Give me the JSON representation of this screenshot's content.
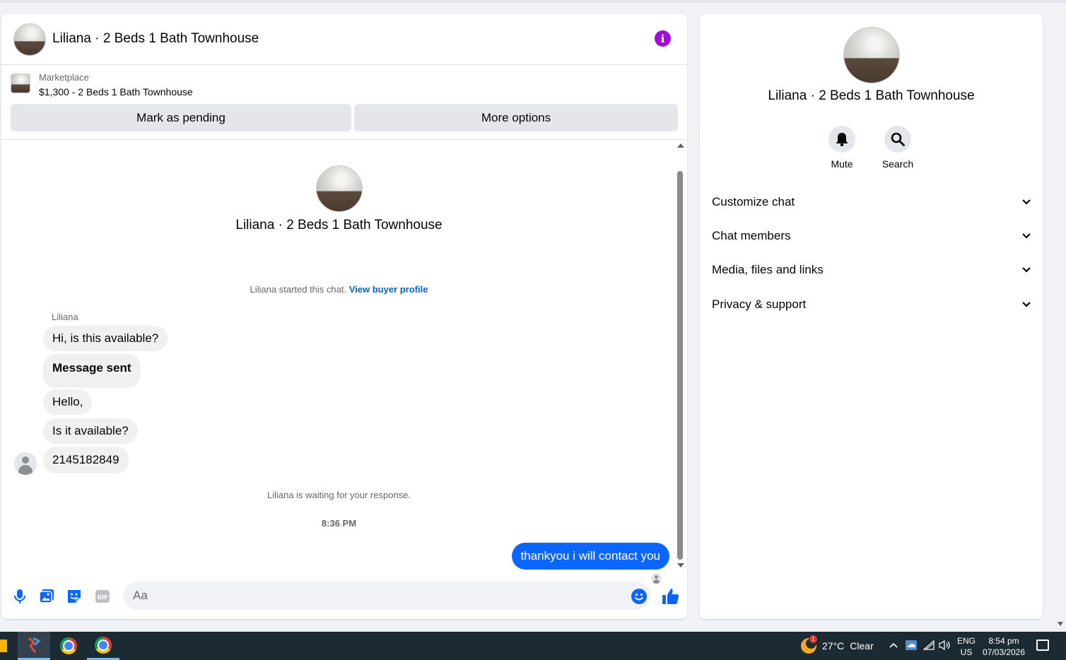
{
  "header": {
    "title": "Liliana · 2 Beds 1 Bath Townhouse"
  },
  "listing": {
    "source": "Marketplace",
    "price_title": "$1,300 - 2 Beds 1 Bath Townhouse",
    "mark_pending_label": "Mark as pending",
    "more_options_label": "More options"
  },
  "conversation": {
    "title": "Liliana · 2 Beds 1 Bath Townhouse",
    "started_text": "Liliana started this chat.",
    "view_profile_label": "View buyer profile",
    "sender_name": "Liliana",
    "incoming": [
      "Hi, is this available?",
      "Message sent",
      "Hello,",
      "Is it available?",
      "2145182849"
    ],
    "waiting_text": "Liliana is waiting for your response.",
    "timestamp": "8:36 PM",
    "outgoing": [
      "thankyou i  will contact you"
    ]
  },
  "composer": {
    "placeholder": "Aa"
  },
  "info_panel": {
    "title": "Liliana · 2 Beds 1 Bath Townhouse",
    "actions": [
      {
        "label": "Mute",
        "icon": "bell-icon"
      },
      {
        "label": "Search",
        "icon": "search-icon"
      }
    ],
    "sections": [
      "Customize chat",
      "Chat members",
      "Media, files and links",
      "Privacy & support"
    ]
  },
  "taskbar": {
    "weather_temp": "27°C",
    "weather_desc": "Clear",
    "weather_badge": "1",
    "lang_top": "ENG",
    "lang_bottom": "US",
    "time": "8:54 pm",
    "date": "07/03/2026"
  },
  "colors": {
    "accent": "#0a66ff",
    "info_icon": "#a20bd9",
    "link": "#0064d1"
  }
}
